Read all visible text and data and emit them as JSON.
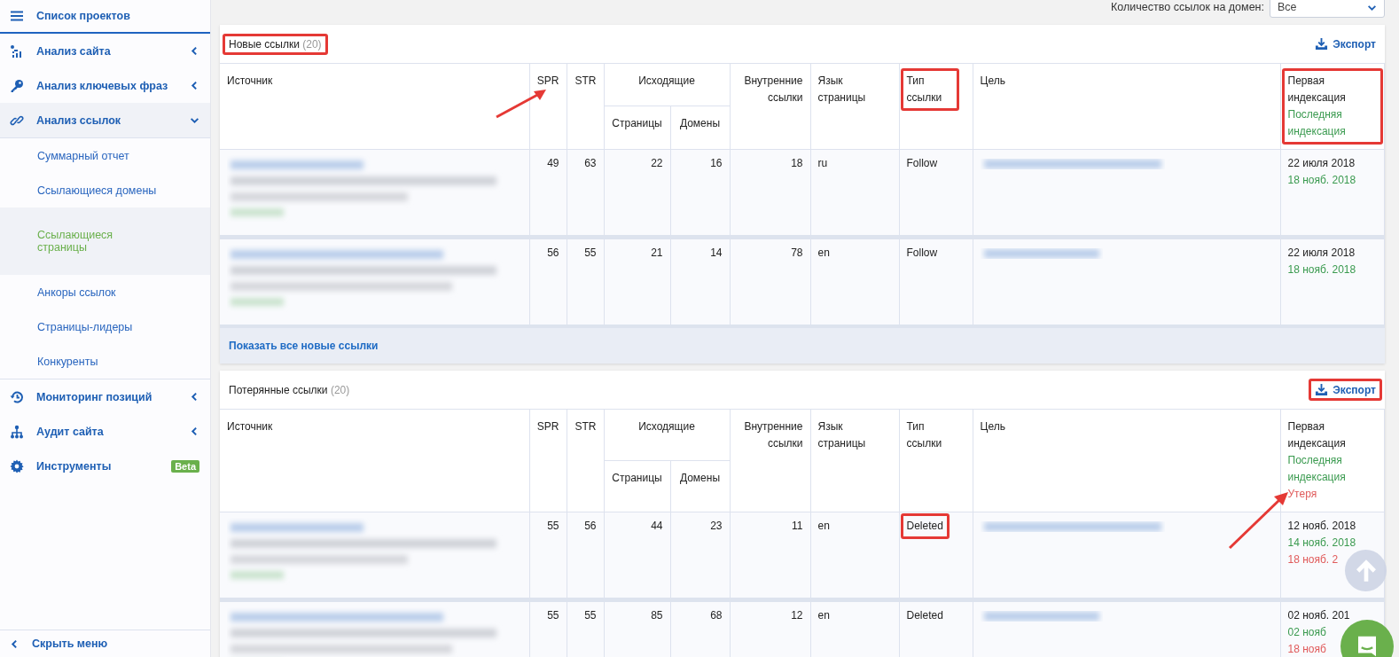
{
  "sidebar": {
    "header": {
      "label": "Список проектов"
    },
    "items": [
      {
        "label": "Анализ сайта",
        "expanded": false,
        "selected": false
      },
      {
        "label": "Анализ ключевых фраз",
        "expanded": false,
        "selected": false
      },
      {
        "label": "Анализ ссылок",
        "expanded": true,
        "selected": true,
        "children": [
          {
            "label": "Суммарный отчет",
            "selected": false
          },
          {
            "label": "Ссылающиеся домены",
            "selected": false
          },
          {
            "label": "Ссылающиеся страницы",
            "selected": true
          },
          {
            "label": "Анкоры ссылок",
            "selected": false
          },
          {
            "label": "Страницы-лидеры",
            "selected": false
          },
          {
            "label": "Конкуренты",
            "selected": false
          }
        ]
      },
      {
        "label": "Мониторинг позиций",
        "expanded": false,
        "selected": false
      },
      {
        "label": "Аудит сайта",
        "expanded": false,
        "selected": false
      },
      {
        "label": "Инструменты",
        "badge": "Beta",
        "selected": false
      }
    ],
    "footer": "Скрыть меню"
  },
  "filter": {
    "label": "Количество ссылок на домен:",
    "value": "Все"
  },
  "sections": [
    {
      "title": "Новые ссылки",
      "count": "(20)",
      "highlighted": true,
      "export": {
        "label": "Экспорт",
        "highlighted": false
      },
      "columns": {
        "source": "Источник",
        "spr": {
          "label": "SPR",
          "arrow": true
        },
        "str": "STR",
        "outgoing": "Исходящие",
        "pages": "Страницы",
        "domains": "Домены",
        "internal": "Внутренние ссылки",
        "lang": "Язык страницы",
        "link_type": {
          "label": "Тип ссылки",
          "highlighted": true
        },
        "target": "Цель",
        "dates": {
          "highlighted": true,
          "lines": [
            {
              "text": "Первая индексация",
              "kind": "first"
            },
            {
              "text": "Последняя индексация",
              "kind": "last"
            }
          ]
        }
      },
      "rows": [
        {
          "spr": "49",
          "str": "63",
          "pages": "22",
          "domains": "16",
          "internal": "18",
          "lang": "ru",
          "link_type": "Follow",
          "link_type_highlighted": false,
          "dates": [
            {
              "text": "22 июля 2018",
              "kind": "first"
            },
            {
              "text": "18 нояб. 2018",
              "kind": "last"
            }
          ]
        },
        {
          "spr": "56",
          "str": "55",
          "pages": "21",
          "domains": "14",
          "internal": "78",
          "lang": "en",
          "link_type": "Follow",
          "link_type_highlighted": false,
          "dates": [
            {
              "text": "22 июля 2018",
              "kind": "first"
            },
            {
              "text": "18 нояб. 2018",
              "kind": "last"
            }
          ]
        }
      ],
      "footer_link": "Показать все новые ссылки"
    },
    {
      "title": "Потерянные ссылки",
      "count": "(20)",
      "highlighted": false,
      "export": {
        "label": "Экспорт",
        "highlighted": true
      },
      "columns": {
        "source": "Источник",
        "spr": {
          "label": "SPR"
        },
        "str": "STR",
        "outgoing": "Исходящие",
        "pages": "Страницы",
        "domains": "Домены",
        "internal": "Внутренние ссылки",
        "lang": "Язык страницы",
        "link_type": {
          "label": "Тип ссылки",
          "highlighted": false
        },
        "target": "Цель",
        "dates": {
          "highlighted": false,
          "arrow": true,
          "lines": [
            {
              "text": "Первая индексация",
              "kind": "first"
            },
            {
              "text": "Последняя индексация",
              "kind": "last"
            },
            {
              "text": "Утеря",
              "kind": "lost"
            }
          ]
        }
      },
      "rows": [
        {
          "spr": "55",
          "str": "56",
          "pages": "44",
          "domains": "23",
          "internal": "11",
          "lang": "en",
          "link_type": "Deleted",
          "link_type_highlighted": true,
          "dates": [
            {
              "text": "12 нояб. 2018",
              "kind": "first"
            },
            {
              "text": "14 нояб. 2018",
              "kind": "last"
            },
            {
              "text": "18 нояб. 2",
              "kind": "lost"
            }
          ]
        },
        {
          "spr": "55",
          "str": "55",
          "pages": "85",
          "domains": "68",
          "internal": "12",
          "lang": "en",
          "link_type": "Deleted",
          "link_type_highlighted": false,
          "dates": [
            {
              "text": "02 нояб. 201",
              "kind": "first"
            },
            {
              "text": "02 нояб",
              "kind": "last"
            },
            {
              "text": "18 нояб",
              "kind": "lost"
            }
          ]
        }
      ]
    }
  ]
}
